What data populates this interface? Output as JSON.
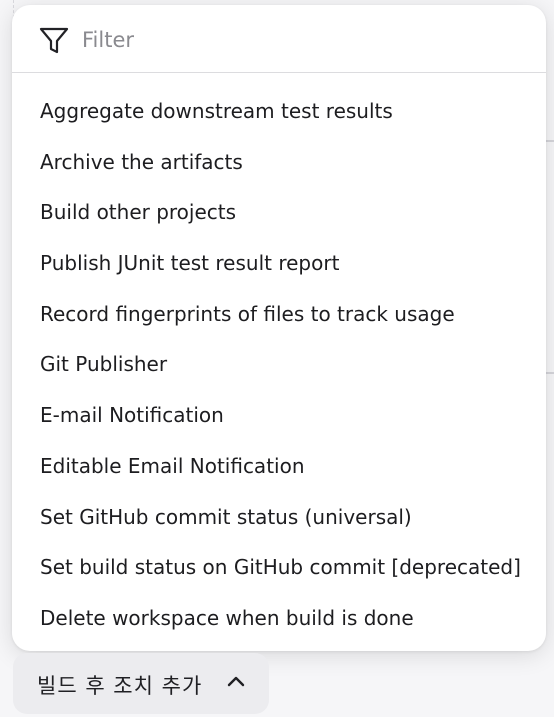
{
  "filter": {
    "placeholder": "Filter",
    "value": "",
    "icon": "filter-icon"
  },
  "menu": {
    "items": [
      {
        "label": "Aggregate downstream test results"
      },
      {
        "label": "Archive the artifacts"
      },
      {
        "label": "Build other projects"
      },
      {
        "label": "Publish JUnit test result report"
      },
      {
        "label": "Record fingerprints of files to track usage"
      },
      {
        "label": "Git Publisher"
      },
      {
        "label": "E-mail Notification"
      },
      {
        "label": "Editable Email Notification"
      },
      {
        "label": "Set GitHub commit status (universal)"
      },
      {
        "label": "Set build status on GitHub commit [deprecated]"
      },
      {
        "label": "Delete workspace when build is done"
      }
    ]
  },
  "add_post_build": {
    "label": "빌드 후 조치 추가",
    "icon": "chevron-up-icon"
  },
  "colors": {
    "menu_background": "#ffffff",
    "page_background": "#f6f6f8",
    "button_background": "#ececef",
    "text": "#1d1d20",
    "placeholder": "#8a8a8f"
  }
}
